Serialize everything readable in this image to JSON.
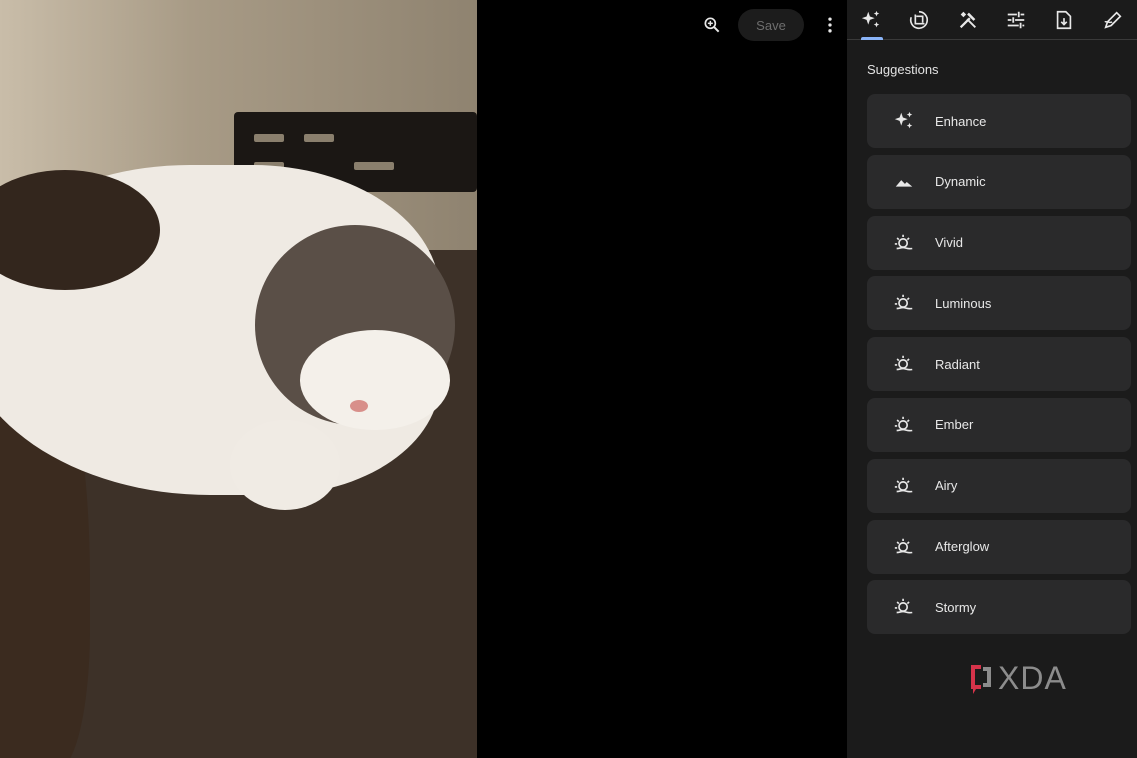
{
  "toolbar": {
    "save_label": "Save",
    "icons": [
      "zoom-in-icon",
      "more-vert-icon"
    ]
  },
  "panel": {
    "tabs": [
      {
        "name": "suggestions",
        "icon": "auto-awesome-icon",
        "active": true
      },
      {
        "name": "crop-rotate",
        "icon": "crop-rotate-icon",
        "active": false
      },
      {
        "name": "tools",
        "icon": "tools-icon",
        "active": false
      },
      {
        "name": "adjust",
        "icon": "tune-icon",
        "active": false
      },
      {
        "name": "export",
        "icon": "export-icon",
        "active": false
      },
      {
        "name": "markup",
        "icon": "markup-icon",
        "active": false
      }
    ],
    "section_title": "Suggestions",
    "items": [
      {
        "label": "Enhance",
        "icon": "sparkle-icon"
      },
      {
        "label": "Dynamic",
        "icon": "mountain-icon"
      },
      {
        "label": "Vivid",
        "icon": "weather-icon"
      },
      {
        "label": "Luminous",
        "icon": "weather-icon"
      },
      {
        "label": "Radiant",
        "icon": "weather-icon"
      },
      {
        "label": "Ember",
        "icon": "weather-icon"
      },
      {
        "label": "Airy",
        "icon": "weather-icon"
      },
      {
        "label": "Afterglow",
        "icon": "weather-icon"
      },
      {
        "label": "Stormy",
        "icon": "weather-icon"
      }
    ]
  },
  "watermark": {
    "text": "XDA"
  },
  "colors": {
    "accent": "#8ab4f8",
    "panel_bg": "#1b1b1b",
    "item_bg": "#2a2a2b",
    "logo_red": "#d6334a"
  }
}
